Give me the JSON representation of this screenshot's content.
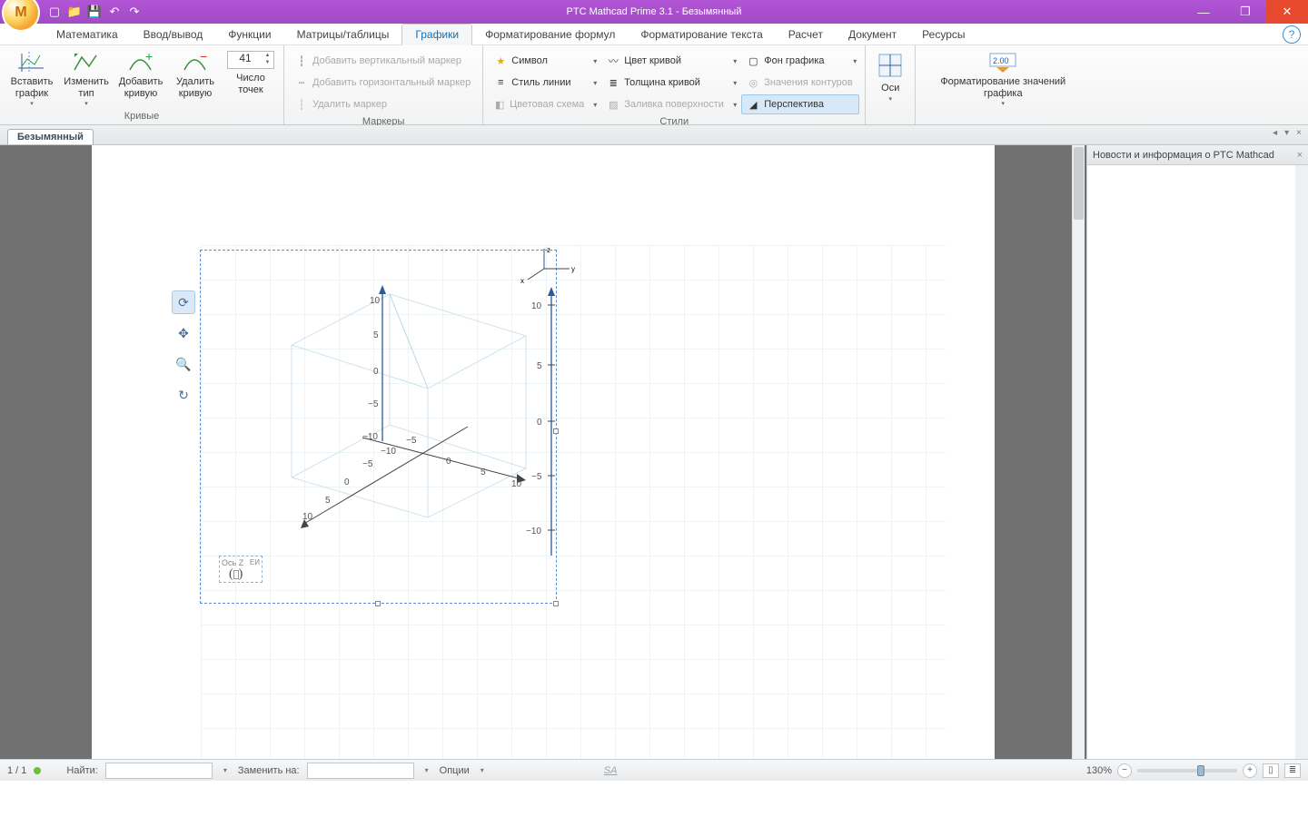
{
  "app": {
    "title": "PTC Mathcad Prime 3.1 - Безымянный"
  },
  "qat": {
    "new": "",
    "open": "",
    "save": "",
    "undo": "",
    "redo": ""
  },
  "tabs": {
    "math": "Математика",
    "io": "Ввод/вывод",
    "func": "Функции",
    "matrix": "Матрицы/таблицы",
    "plots": "Графики",
    "fmtformula": "Форматирование формул",
    "fmttext": "Форматирование текста",
    "calc": "Расчет",
    "doc": "Документ",
    "res": "Ресурсы"
  },
  "ribbon": {
    "curves": {
      "label": "Кривые",
      "insert": "Вставить\nграфик",
      "change": "Изменить\nтип",
      "add": "Добавить\nкривую",
      "del": "Удалить\nкривую",
      "points_label": "Число\nточек",
      "points_value": "41"
    },
    "markers": {
      "label": "Маркеры",
      "addv": "Добавить вертикальный маркер",
      "addh": "Добавить горизонтальный маркер",
      "delm": "Удалить маркер"
    },
    "styles": {
      "label": "Стили",
      "symbol": "Символ",
      "linestyle": "Стиль линии",
      "colorscheme": "Цветовая схема",
      "curvecolor": "Цвет кривой",
      "thickness": "Толщина кривой",
      "surffill": "Заливка поверхности",
      "bg": "Фон графика",
      "contours": "Значения контуров",
      "perspective": "Перспектива"
    },
    "axes": "Оси",
    "format": "Форматирование значений графика"
  },
  "doc_tab": "Безымянный",
  "side_panel": {
    "title": "Новости и информация о PTC Mathcad"
  },
  "plot": {
    "z_label": "Ось Z",
    "z_unit": "ЕИ",
    "xticks": [
      "−10",
      "−5",
      "0",
      "5",
      "10"
    ],
    "yticks": [
      "−10",
      "−5",
      "0",
      "5",
      "10"
    ],
    "zticks": [
      "10",
      "5",
      "0",
      "−5",
      "−10"
    ],
    "side_ticks": [
      "10",
      "5",
      "0",
      "−5",
      "−10"
    ],
    "mini_axes": {
      "x": "x",
      "y": "y",
      "z": "z"
    }
  },
  "status": {
    "page": "1 / 1",
    "find": "Найти:",
    "replace": "Заменить на:",
    "options": "Опции",
    "zoom": "130%",
    "sa": "SA"
  }
}
